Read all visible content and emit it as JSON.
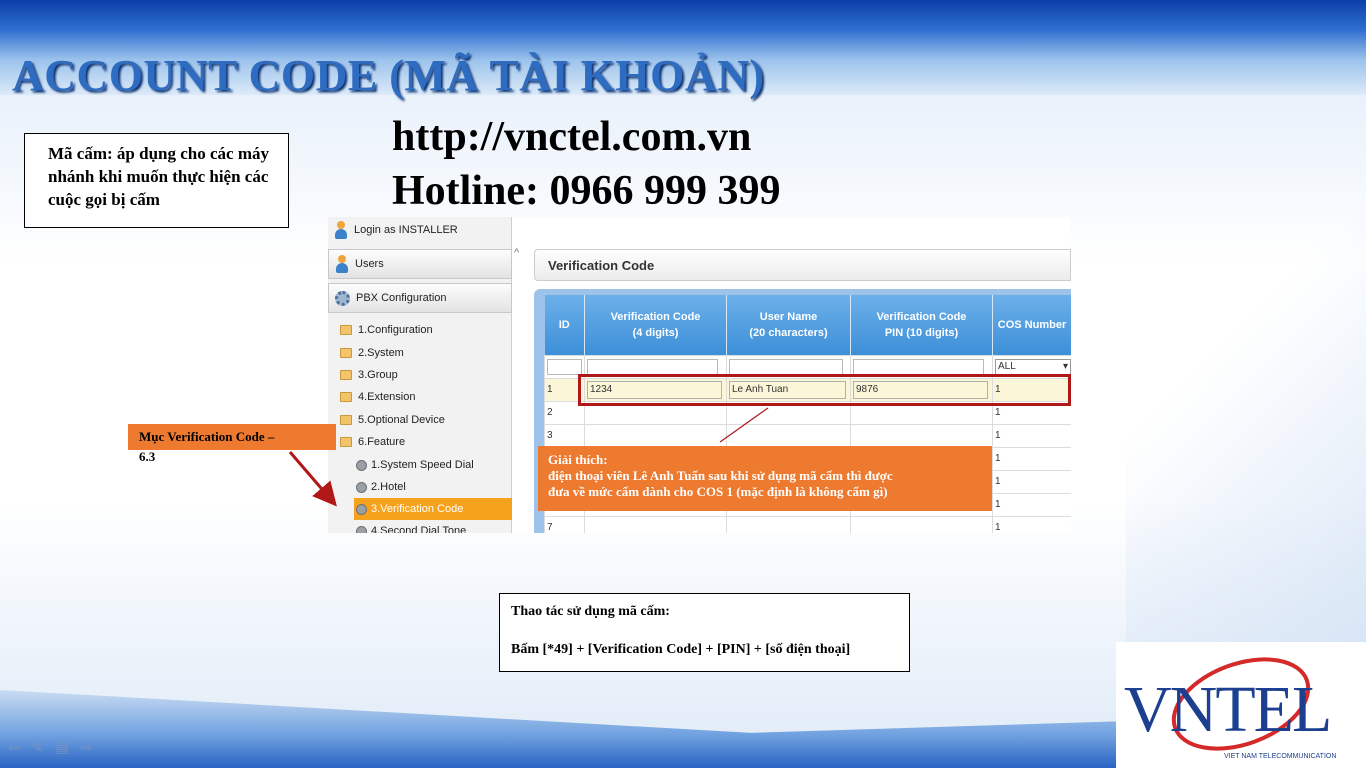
{
  "slide": {
    "title": "ACCOUNT CODE (MÃ TÀI KHOẢN)",
    "url": "http://vnctel.com.vn",
    "hotline": "Hotline: 0966 999 399",
    "note": "Mã cấm: áp dụng cho các máy nhánh khi muốn thực hiện các cuộc gọi bị cấm"
  },
  "app": {
    "login": "Login as INSTALLER",
    "users": "Users",
    "pbx": "PBX Configuration",
    "tree": [
      "1.Configuration",
      "2.System",
      "3.Group",
      "4.Extension",
      "5.Optional Device",
      "6.Feature"
    ],
    "feature_items": [
      "1.System Speed Dial",
      "2.Hotel",
      "3.Verification Code",
      "4.Second Dial Tone"
    ],
    "panel_title": "Verification Code",
    "columns": {
      "id": "ID",
      "code_1": "Verification Code",
      "code_2": "(4 digits)",
      "user_1": "User Name",
      "user_2": "(20 characters)",
      "pin_1": "Verification Code",
      "pin_2": "PIN (10 digits)",
      "cos": "COS Number"
    },
    "filter_cos": "ALL",
    "rows": [
      {
        "id": "1",
        "code": "1234",
        "user": "Le Anh Tuan",
        "pin": "9876",
        "cos": "1"
      },
      {
        "id": "2",
        "code": "",
        "user": "",
        "pin": "",
        "cos": "1"
      },
      {
        "id": "3",
        "code": "",
        "user": "",
        "pin": "",
        "cos": "1"
      },
      {
        "id": "",
        "code": "",
        "user": "",
        "pin": "",
        "cos": "1"
      },
      {
        "id": "",
        "code": "",
        "user": "",
        "pin": "",
        "cos": "1"
      },
      {
        "id": "",
        "code": "",
        "user": "",
        "pin": "",
        "cos": "1"
      },
      {
        "id": "7",
        "code": "",
        "user": "",
        "pin": "",
        "cos": "1"
      }
    ]
  },
  "callouts": {
    "verif_label": "Mục Verification Code –",
    "verif_label_tail": "6.3",
    "explain_title": "Giải thích:",
    "explain_line1": "điện thoại viên Lê Anh Tuấn sau khi sử dụng mã cấm thì được",
    "explain_line2": "đưa về mức cấm dành cho COS 1 (mặc định là không cấm gì)",
    "usage_title": "Thao tác sử dụng mã cấm:",
    "usage_text": "Bấm [*49] + [Verification Code] + [PIN] + [số điện thoại]"
  },
  "logo": {
    "text": "VNTEL",
    "sub": "VIET NAM TELECOMMUNICATION"
  },
  "colors": {
    "title": "#2e6cc1",
    "callout": "#ee7a2f",
    "highlight": "#b01717",
    "selected_menu": "#f7a21c",
    "grid_header": "#3d8fd8"
  }
}
